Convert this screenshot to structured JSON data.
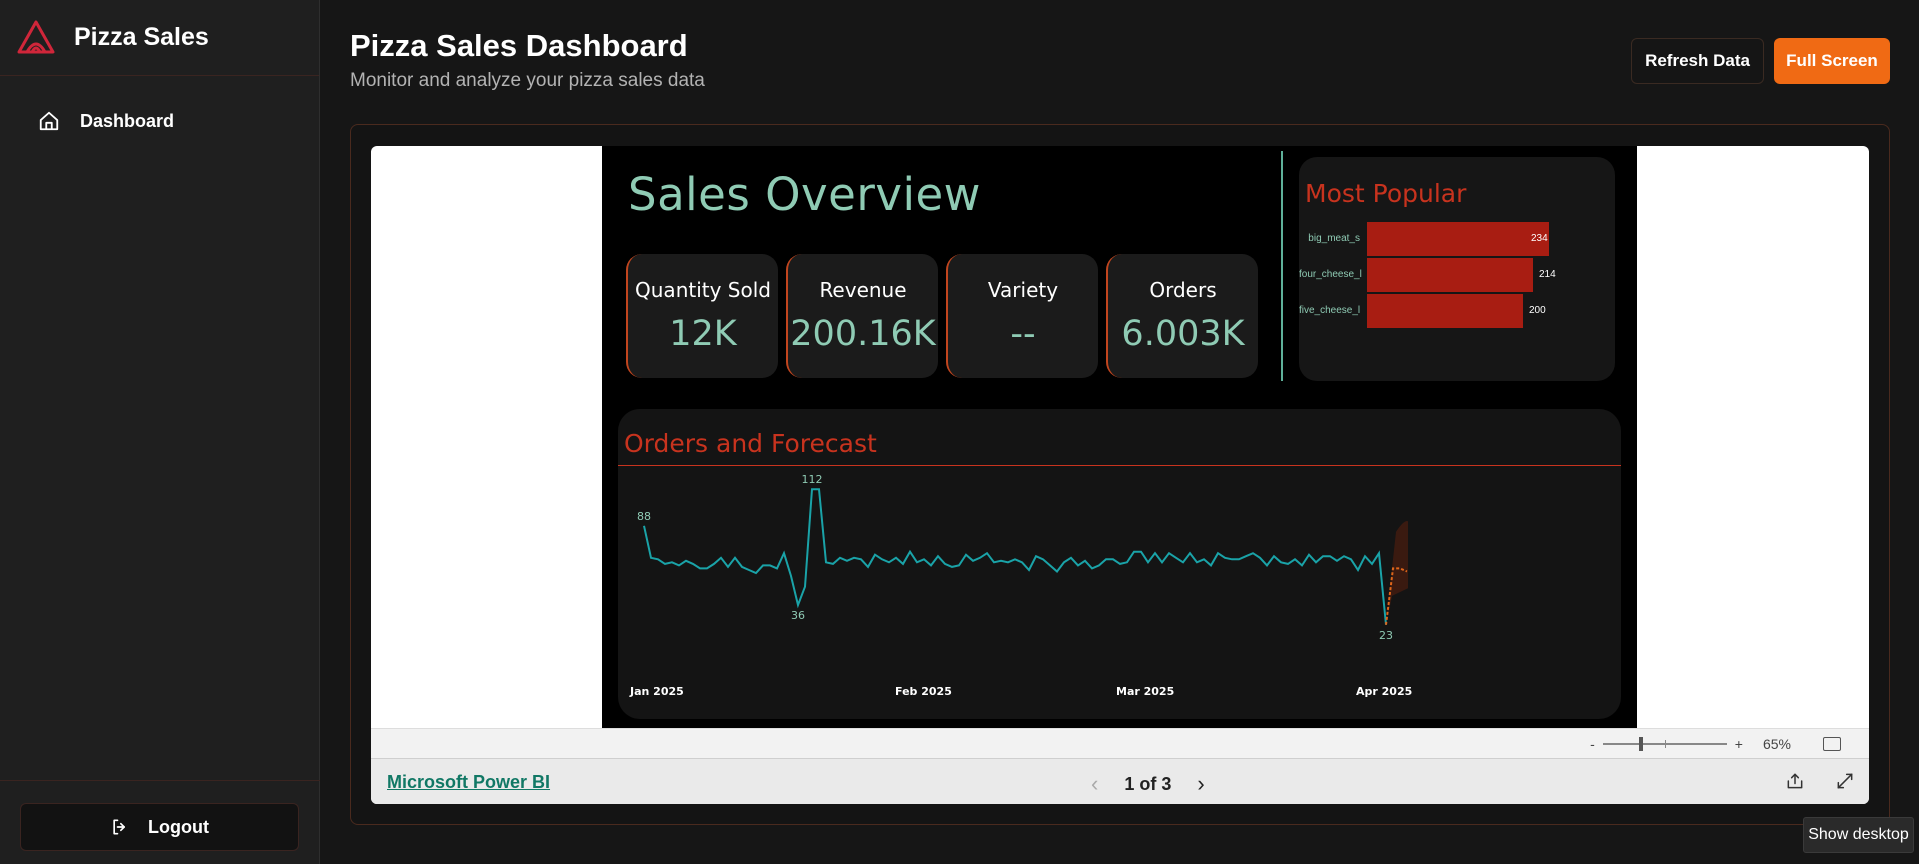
{
  "app": {
    "name": "Pizza Sales"
  },
  "sidebar": {
    "items": [
      {
        "label": "Dashboard"
      }
    ],
    "logout_label": "Logout"
  },
  "header": {
    "title": "Pizza Sales Dashboard",
    "subtitle": "Monitor and analyze your pizza sales data",
    "refresh_label": "Refresh Data",
    "fullscreen_label": "Full Screen"
  },
  "colors": {
    "accent": "#f06a14",
    "teal": "#8fcbb4",
    "red": "#c8331e",
    "bar": "#a81d12",
    "line": "#1aa3a8"
  },
  "report": {
    "title": "Sales Overview",
    "kpis": [
      {
        "label": "Quantity Sold",
        "value": "12K"
      },
      {
        "label": "Revenue",
        "value": "200.16K"
      },
      {
        "label": "Variety",
        "value": "--"
      },
      {
        "label": "Orders",
        "value": "6.003K"
      }
    ],
    "popular": {
      "title": "Most Popular",
      "items": [
        {
          "name": "big_meat_s",
          "value": 234
        },
        {
          "name": "four_cheese_l",
          "value": 214
        },
        {
          "name": "five_cheese_l",
          "value": 200
        }
      ]
    },
    "forecast_title": "Orders and Forecast"
  },
  "chart_data": {
    "type": "line",
    "title": "Orders and Forecast",
    "x_ticks": [
      "Jan 2025",
      "Feb 2025",
      "Mar 2025",
      "Apr 2025"
    ],
    "series": [
      {
        "values": [
          88,
          67,
          66,
          63,
          64,
          62,
          65,
          63,
          60,
          60,
          63,
          67,
          61,
          67,
          61,
          59,
          57,
          62,
          62,
          60,
          70,
          55,
          36,
          48,
          112,
          112,
          64,
          63,
          67,
          65,
          67,
          66,
          61,
          69,
          66,
          64,
          67,
          63,
          71,
          64,
          66,
          62,
          68,
          63,
          61,
          62,
          69,
          65,
          67,
          70,
          64,
          65,
          64,
          66,
          64,
          59,
          68,
          66,
          62,
          58,
          64,
          67,
          62,
          65,
          60,
          62,
          66,
          66,
          63,
          64,
          71,
          71,
          64,
          70,
          64,
          70,
          67,
          64,
          70,
          64,
          66,
          62,
          70,
          67,
          66,
          66,
          68,
          70,
          67,
          62,
          68,
          64,
          63,
          66,
          62,
          69,
          64,
          68,
          68,
          65,
          68,
          66,
          59,
          68,
          63,
          70,
          23
        ]
      },
      {
        "values": [
          23,
          60,
          60,
          58
        ]
      }
    ],
    "annotations": [
      {
        "x_index": 0,
        "label": "88"
      },
      {
        "x_index": 24,
        "label": "112"
      },
      {
        "x_index": 22,
        "label": "36"
      },
      {
        "x_index": 106,
        "label": "23"
      }
    ],
    "ylim": [
      15,
      120
    ],
    "grid": false
  },
  "viewer": {
    "zoom_minus": "-",
    "zoom_plus": "+",
    "zoom_label": "65%",
    "link_label": "Microsoft Power BI",
    "page_label": "1 of 3",
    "prev": "‹",
    "next": "›"
  },
  "tooltip": "Show desktop"
}
